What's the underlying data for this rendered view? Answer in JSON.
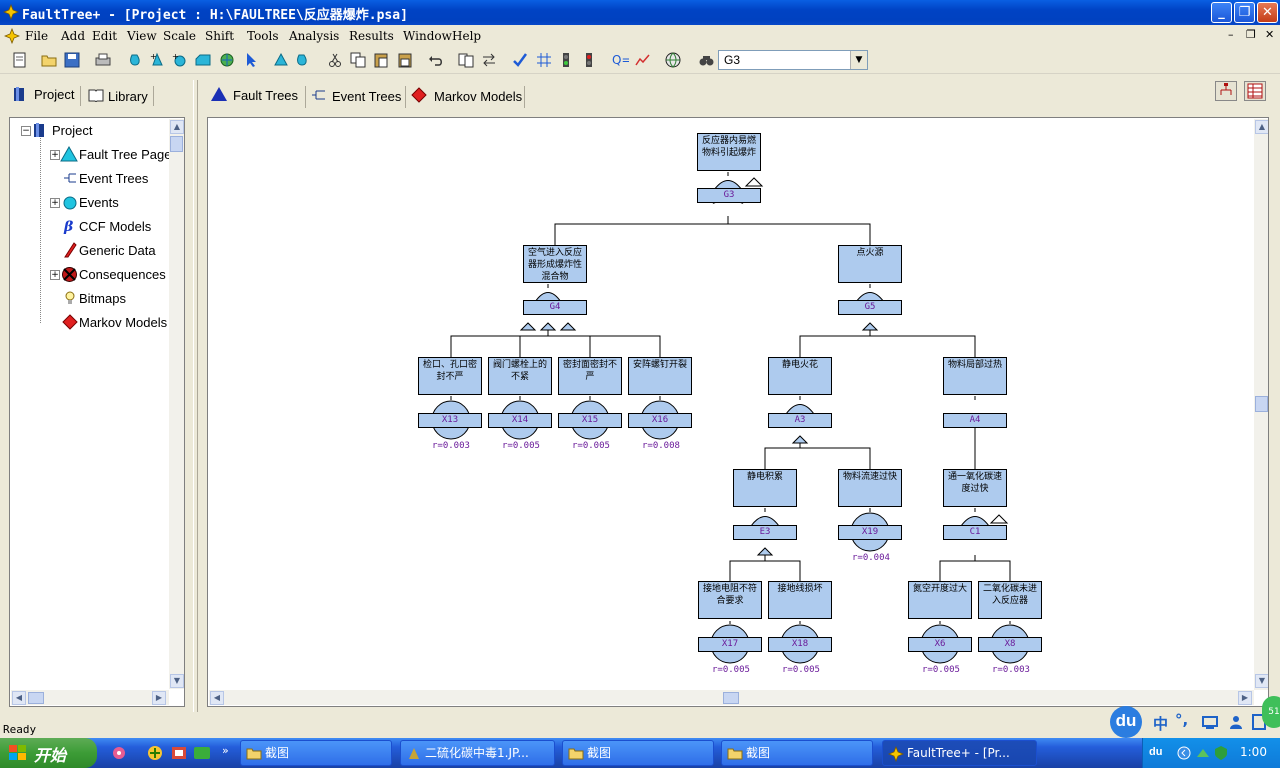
{
  "window": {
    "title": "FaultTree+ - [Project : H:\\FAULTREE\\反应器爆炸.psa]"
  },
  "menu": [
    "File",
    "Add",
    "Edit",
    "View",
    "Scale",
    "Shift",
    "Tools",
    "Analysis",
    "Results",
    "Window",
    "Help"
  ],
  "toolbar": {
    "combo_value": "G3"
  },
  "left_tabs": {
    "project": "Project",
    "library": "Library"
  },
  "tree": {
    "root": "Project",
    "items": [
      "Fault Tree Pages",
      "Event Trees",
      "Events",
      "CCF Models",
      "Generic Data",
      "Consequences",
      "Bitmaps",
      "Markov Models"
    ]
  },
  "right_tabs": {
    "fault_trees": "Fault Trees",
    "event_trees": "Event Trees",
    "markov": "Markov Models"
  },
  "fault_tree": {
    "g3": {
      "label": "G3",
      "text": [
        "反应器内易燃",
        "物料引起爆炸"
      ]
    },
    "g4": {
      "label": "G4",
      "text": [
        "空气进入反应",
        "器形成爆炸性",
        "混合物"
      ]
    },
    "g5": {
      "label": "G5",
      "text": [
        "点火源"
      ]
    },
    "x13": {
      "label": "X13",
      "text": [
        "检口、孔口密",
        "封不严"
      ],
      "prob": "r=0.003"
    },
    "x14": {
      "label": "X14",
      "text": [
        "阀门螺栓上的",
        "不紧"
      ],
      "prob": "r=0.005"
    },
    "x15": {
      "label": "X15",
      "text": [
        "密封面密封不",
        "严"
      ],
      "prob": "r=0.005"
    },
    "x16": {
      "label": "X16",
      "text": [
        "安阵螺钉开裂"
      ],
      "prob": "r=0.008"
    },
    "a3": {
      "label": "A3",
      "text": [
        "静电火花"
      ]
    },
    "a4": {
      "label": "A4",
      "text": [
        "物料局部过热"
      ]
    },
    "e3": {
      "label": "E3",
      "text": [
        "静电积累"
      ]
    },
    "x19": {
      "label": "X19",
      "text": [
        "物料流速过快"
      ],
      "prob": "r=0.004"
    },
    "c1": {
      "label": "C1",
      "text": [
        "通一氧化碳速",
        "度过快"
      ]
    },
    "x17": {
      "label": "X17",
      "text": [
        "接地电阻不符",
        "合要求"
      ],
      "prob": "r=0.005"
    },
    "x18": {
      "label": "X18",
      "text": [
        "接地线损坏"
      ],
      "prob": "r=0.005"
    },
    "x6": {
      "label": "X6",
      "text": [
        "氮空开度过大"
      ],
      "prob": "r=0.005"
    },
    "x8": {
      "label": "X8",
      "text": [
        "二氧化碳未进",
        "入反应器"
      ],
      "prob": "r=0.003"
    }
  },
  "status": {
    "text": "Ready"
  },
  "taskbar": {
    "start": "开始",
    "tasks": [
      "截图",
      "二硫化碳中毒1.JP...",
      "截图",
      "截图",
      "FaultTree+ - [Pr..."
    ],
    "clock": "1:00",
    "ime": [
      "du",
      "中",
      "°,"
    ]
  },
  "colors": {
    "node_fill": "#aecbee",
    "label_text": "#6a1b9a",
    "titlebar": "#0a5fe2"
  }
}
